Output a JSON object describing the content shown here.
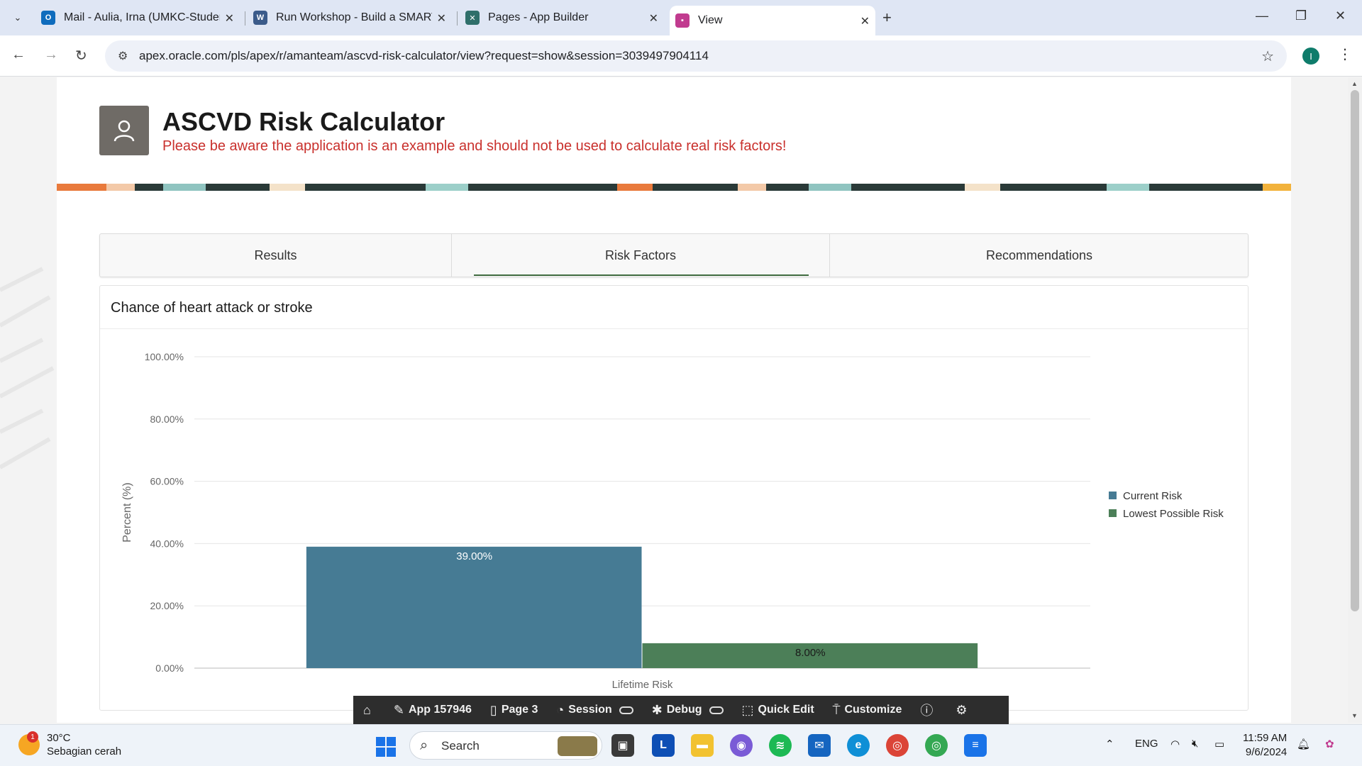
{
  "browser": {
    "tabs": [
      {
        "label": "Mail - Aulia, Irna (UMKC-Studen",
        "icon": "outlook-icon"
      },
      {
        "label": "Run Workshop - Build a SMART",
        "icon": "workshop-icon"
      },
      {
        "label": "Pages - App Builder",
        "icon": "app-builder-icon"
      },
      {
        "label": "View",
        "icon": "apex-view-icon"
      }
    ],
    "url": "apex.oracle.com/pls/apex/r/amanteam/ascvd-risk-calculator/view?request=show&session=3039497904114",
    "profile_initial": "I"
  },
  "header": {
    "title": "ASCVD Risk Calculator",
    "warning": "Please be aware the application is an example and should not be used to calculate real risk factors!",
    "warning_color": "#c9302c"
  },
  "region_tabs": [
    {
      "label": "Results",
      "active": false
    },
    {
      "label": "Risk Factors",
      "active": true
    },
    {
      "label": "Recommendations",
      "active": false
    }
  ],
  "chart": {
    "title": "Chance of heart attack or stroke"
  },
  "chart_data": {
    "type": "bar",
    "title": "Chance of heart attack or stroke",
    "categories": [
      "Lifetime Risk"
    ],
    "series": [
      {
        "name": "Current Risk",
        "values": [
          39.0
        ],
        "color": "#467b94",
        "label": "39.00%"
      },
      {
        "name": "Lowest Possible Risk",
        "values": [
          8.0
        ],
        "color": "#4c7f58",
        "label": "8.00%"
      }
    ],
    "ylabel": "Percent (%)",
    "xlabel": "",
    "ylim": [
      0,
      100
    ],
    "yticks": [
      "0.00%",
      "20.00%",
      "40.00%",
      "60.00%",
      "80.00%",
      "100.00%"
    ],
    "grid": true,
    "legend": "right"
  },
  "dev_toolbar": {
    "home": "home-icon",
    "app": "App 157946",
    "page": "Page 3",
    "session": "Session",
    "debug": "Debug",
    "quick_edit": "Quick Edit",
    "customize": "Customize"
  },
  "taskbar": {
    "weather_temp": "30°C",
    "weather_desc": "Sebagian cerah",
    "weather_badge": "1",
    "search_placeholder": "Search",
    "language": "ENG",
    "time": "11:59 AM",
    "date": "9/6/2024"
  }
}
